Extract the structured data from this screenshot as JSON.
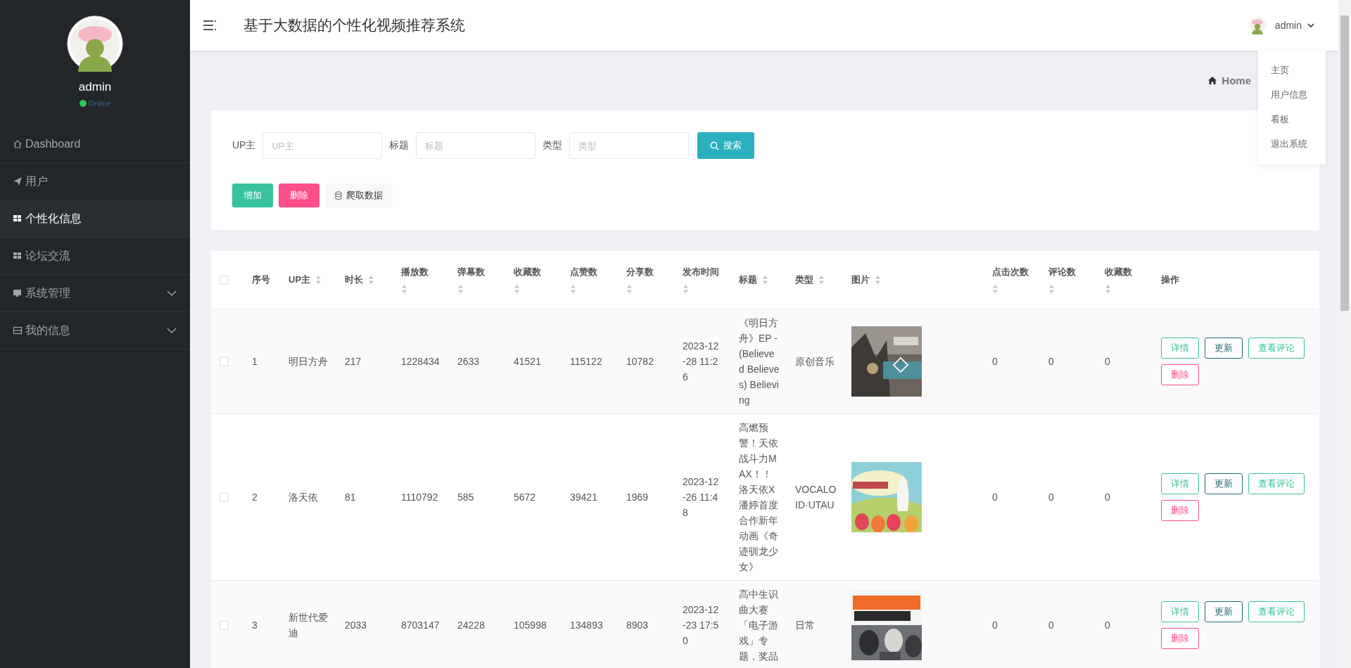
{
  "sidebar": {
    "user": {
      "name": "admin",
      "status": "Online",
      "color": "#2dc653"
    },
    "items": [
      {
        "label": "Dashboard",
        "kind": "home",
        "selected": false
      },
      {
        "label": "用户",
        "kind": "plane",
        "selected": false
      },
      {
        "label": "个性化信息",
        "kind": "grid",
        "selected": true
      },
      {
        "label": "论坛交流",
        "kind": "grid",
        "selected": false
      },
      {
        "label": "系统管理",
        "kind": "monitor",
        "selected": false,
        "expanded": false
      },
      {
        "label": "我的信息",
        "kind": "card",
        "selected": false,
        "expanded": false
      }
    ]
  },
  "header": {
    "title": "基于大数据的个性化视频推荐系统",
    "user": "admin",
    "menu": {
      "open": true,
      "items": [
        "主页",
        "用户信息",
        "看板",
        "退出系统"
      ]
    }
  },
  "breadcrumb": {
    "label": "Home"
  },
  "search": {
    "fields": [
      {
        "label": "UP主",
        "placeholder": "UP主"
      },
      {
        "label": "标题",
        "placeholder": "标题"
      },
      {
        "label": "类型",
        "placeholder": "类型"
      }
    ],
    "button": "搜索"
  },
  "actions": [
    {
      "label": "增加",
      "kind": "add"
    },
    {
      "label": "删除",
      "kind": "delete"
    },
    {
      "label": "爬取数据",
      "kind": "crawl"
    }
  ],
  "table": {
    "select_all": false,
    "columns": [
      {
        "label": "序号",
        "kind": "text",
        "sortable": false
      },
      {
        "label": "UP主",
        "kind": "text",
        "sortable": true
      },
      {
        "label": "时长",
        "kind": "text",
        "sortable": true
      },
      {
        "label": "播放数",
        "kind": "text",
        "sortable": true
      },
      {
        "label": "弹幕数",
        "kind": "text",
        "sortable": true
      },
      {
        "label": "收藏数",
        "kind": "text",
        "sortable": true
      },
      {
        "label": "点赞数",
        "kind": "text",
        "sortable": true
      },
      {
        "label": "分享数",
        "kind": "text",
        "sortable": true
      },
      {
        "label": "发布时间",
        "kind": "text",
        "sortable": true
      },
      {
        "label": "标题",
        "kind": "text",
        "sortable": true
      },
      {
        "label": "类型",
        "kind": "text",
        "sortable": true
      },
      {
        "label": "图片",
        "kind": "picture",
        "sortable": true
      },
      {
        "label": "点击次数",
        "kind": "text",
        "sortable": true
      },
      {
        "label": "评论数",
        "kind": "text",
        "sortable": true
      },
      {
        "label": "收藏数",
        "kind": "text",
        "sortable": true
      },
      {
        "label": "操作",
        "kind": "actions",
        "sortable": false
      }
    ],
    "rows": [
      {
        "checked": false,
        "cells": [
          "1",
          "明日方舟",
          "217",
          "1228434",
          "2633",
          "41521",
          "115122",
          "10782",
          "2023-12-28 11:26",
          "《明日方舟》EP -(Believed Believes) Believing",
          "原创音乐",
          "",
          "0",
          "0",
          "0"
        ],
        "actions": [
          {
            "label": "详情",
            "kind": "detail"
          },
          {
            "label": "更新",
            "kind": "update"
          },
          {
            "label": "查看评论",
            "kind": "comments"
          },
          {
            "label": "删除",
            "kind": "delete"
          }
        ]
      },
      {
        "checked": false,
        "cells": [
          "2",
          "洛天依",
          "81",
          "1110792",
          "585",
          "5672",
          "39421",
          "1969",
          "2023-12-26 11:48",
          "高燃预警！天依战斗力MAX！！洛天依X潘婷首度合作新年动画《奇迹驯龙少女》",
          "VOCALOID·UTAU",
          "",
          "0",
          "0",
          "0"
        ],
        "actions": [
          {
            "label": "详情",
            "kind": "detail"
          },
          {
            "label": "更新",
            "kind": "update"
          },
          {
            "label": "查看评论",
            "kind": "comments"
          },
          {
            "label": "删除",
            "kind": "delete"
          }
        ]
      },
      {
        "checked": false,
        "cells": [
          "3",
          "新世代爱迪",
          "2033",
          "8703147",
          "24228",
          "105998",
          "134893",
          "8903",
          "2023-12-23 17:50",
          "高中生识曲大赛「电子游戏」专题，奖品",
          "日常",
          "",
          "0",
          "0",
          "0"
        ],
        "actions": [
          {
            "label": "详情",
            "kind": "detail"
          },
          {
            "label": "更新",
            "kind": "update"
          },
          {
            "label": "查看评论",
            "kind": "comments"
          },
          {
            "label": "删除",
            "kind": "delete"
          }
        ]
      }
    ]
  }
}
